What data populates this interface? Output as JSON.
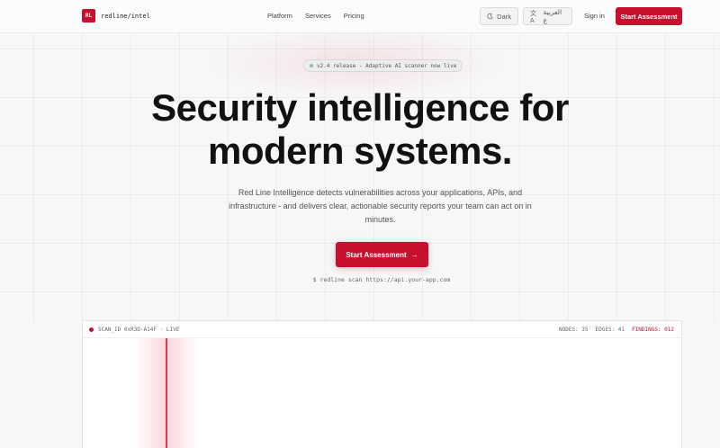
{
  "brand": {
    "logo_mark": "RL",
    "name": "redline/intel",
    "accent": "#c8102e"
  },
  "nav": {
    "links": [
      "Platform",
      "Services",
      "Pricing"
    ],
    "theme_icon": "moon-icon",
    "theme_label": "Dark",
    "lang_icon": "translate-icon",
    "lang_label": "العربية ع",
    "signin": "Sign in",
    "cta": "Start Assessment"
  },
  "hero": {
    "badge": "v2.4 release - Adaptive AI scanner now live",
    "headline_line1": "Security intelligence for",
    "headline_line2": "modern systems.",
    "subtext": "Red Line Intelligence detects vulnerabilities across your applications, APIs, and infrastructure - and delivers clear, actionable security reports your team can act on in minutes.",
    "cta": "Start Assessment",
    "cta_arrow": "→",
    "command": "$ redline scan https://api.your-app.com"
  },
  "scan_panel": {
    "scan_id": "SCAN_ID 0xR3D-A14F · LIVE",
    "nodes": "NODES: 35",
    "edges": "EDGES: 41",
    "findings": "FINDINGS: 012"
  }
}
